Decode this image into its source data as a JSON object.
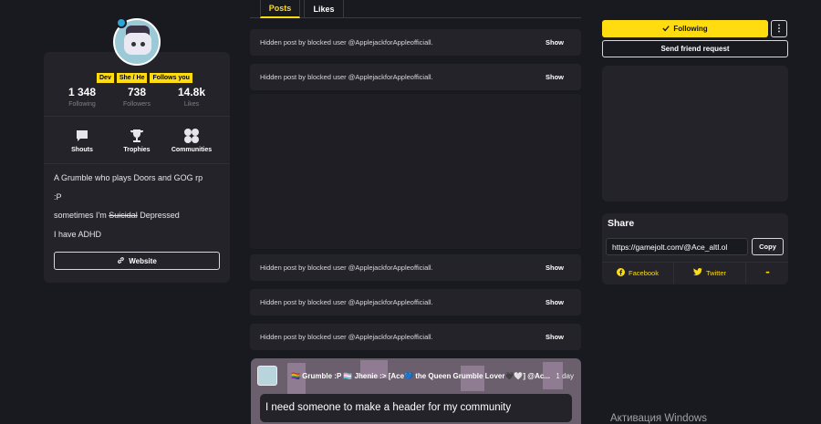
{
  "profile": {
    "tags": [
      "Dev",
      "She / He",
      "Follows you"
    ],
    "stats": [
      {
        "value": "1 348",
        "label": "Following"
      },
      {
        "value": "738",
        "label": "Followers"
      },
      {
        "value": "14.8k",
        "label": "Likes"
      }
    ],
    "quicklinks": [
      "Shouts",
      "Trophies",
      "Communities"
    ],
    "bio": {
      "line1": "A Grumble who plays Doors and GOG rp",
      "line2": ":P",
      "line3_prefix": "sometimes I'm ",
      "line3_strike": "Suicidal",
      "line3_suffix": " Depressed",
      "line4": "I have ADHD"
    },
    "website_label": "Website"
  },
  "tabs": {
    "posts": "Posts",
    "likes": "Likes"
  },
  "feed": {
    "hidden_text": "Hidden post by blocked user @ApplejackforAppleofficiall.",
    "show_label": "Show",
    "community_post": {
      "name": "🏳️‍🌈 Grumble :P 🏳️‍⚧️ Jhenie :> [Ace💙 the Queen Grumble Lover🖤🤍] @Ac...",
      "time": "1 day",
      "message": "I need someone to make a header for my community"
    }
  },
  "sidebar": {
    "following_label": "Following",
    "more_label": "⋮",
    "friend_label": "Send friend request",
    "share": {
      "title": "Share",
      "url": "https://gamejolt.com/@Ace_altl.ol",
      "copy_label": "Copy",
      "facebook_label": "Facebook",
      "twitter_label": "Twitter",
      "more_label": "•••"
    }
  },
  "os": {
    "watermark": "Активация Windows"
  },
  "colors": {
    "accent": "#ffdc0f",
    "background": "#191920",
    "card": "#232329"
  }
}
